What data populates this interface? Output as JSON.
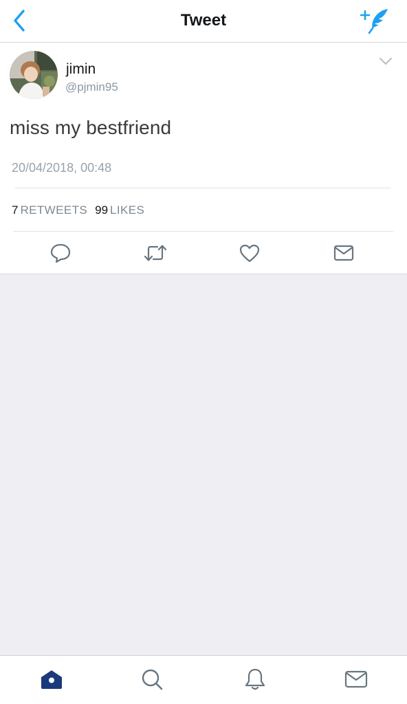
{
  "colors": {
    "accent": "#1da1f2",
    "text_primary": "#14171a",
    "text_secondary": "#8a97a3",
    "icon_gray": "#667580",
    "tab_active": "#1a3a7a",
    "background": "#eeeef3"
  },
  "header": {
    "back_icon": "chevron-left-icon",
    "title": "Tweet",
    "compose_icon": "compose-feather-icon"
  },
  "tweet": {
    "avatar_icon": "user-avatar-photo",
    "display_name": "jimin",
    "handle": "@pjmin95",
    "menu_icon": "chevron-down-icon",
    "text": "miss my bestfriend",
    "timestamp": "20/04/2018, 00:48",
    "stats": {
      "retweets_count": "7",
      "retweets_label": "RETWEETS",
      "likes_count": "99",
      "likes_label": "LIKES"
    },
    "actions": [
      {
        "name": "reply",
        "icon": "reply-bubble-icon"
      },
      {
        "name": "retweet",
        "icon": "retweet-icon"
      },
      {
        "name": "like",
        "icon": "heart-icon"
      },
      {
        "name": "message",
        "icon": "envelope-icon"
      }
    ]
  },
  "tabbar": {
    "items": [
      {
        "name": "home",
        "icon": "home-icon",
        "active": true
      },
      {
        "name": "search",
        "icon": "search-icon",
        "active": false
      },
      {
        "name": "notifications",
        "icon": "bell-icon",
        "active": false
      },
      {
        "name": "messages",
        "icon": "envelope-icon",
        "active": false
      }
    ]
  }
}
